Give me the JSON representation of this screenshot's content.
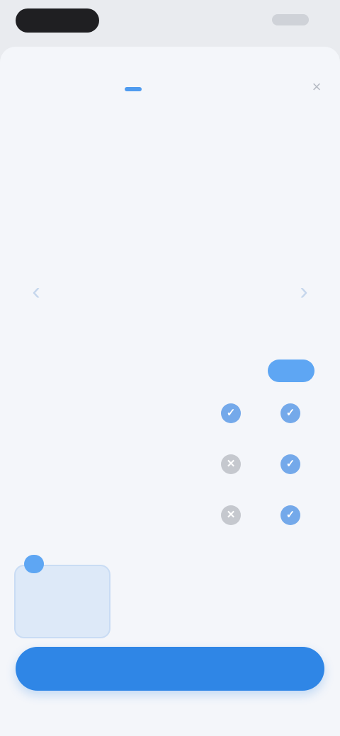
{
  "status_bar": {
    "time": "",
    "right_indicator": ""
  },
  "sheet": {
    "close_glyph": "×",
    "brand": {
      "name": "",
      "badge": ""
    },
    "headline": "",
    "subhead": "",
    "carousel": {
      "left_arrow": "‹",
      "right_arrow": "›",
      "quote": "",
      "author": ""
    },
    "comparison": {
      "title": "",
      "free_label": "",
      "pro_label": "",
      "rows": [
        {
          "feature": "",
          "free": "✓",
          "pro": "✓"
        },
        {
          "feature": "",
          "free": "✕",
          "pro": "✓"
        },
        {
          "feature": "",
          "free": "✕",
          "pro": "✓"
        }
      ]
    },
    "plans": [
      {
        "tag": "",
        "name": "",
        "price": ""
      },
      {
        "tag": "",
        "name": "",
        "price": ""
      },
      {
        "tag": "",
        "name": "",
        "price": ""
      }
    ],
    "cta_label": ""
  },
  "colors": {
    "accent": "#2f86e6",
    "accent_light": "#5ea6f3",
    "check": "#74a9ea",
    "cross": "#c5c8ce",
    "background": "#f4f6fa"
  }
}
